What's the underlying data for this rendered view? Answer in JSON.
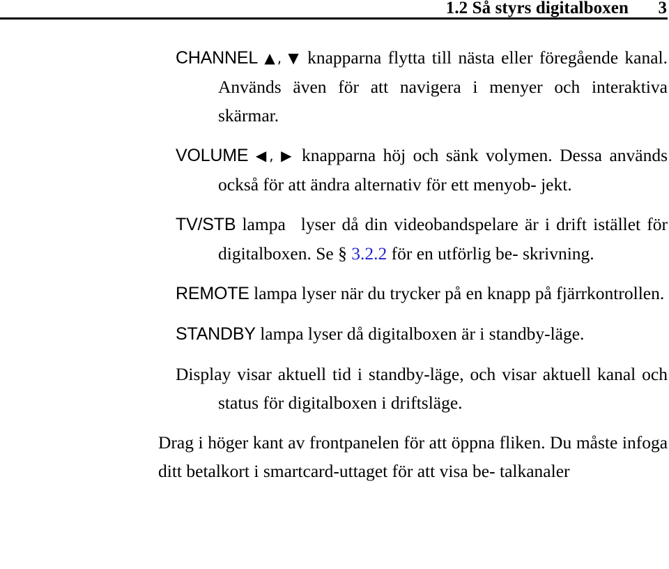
{
  "header": {
    "section_number": "1.2",
    "title": "1.2 Så styrs digitalboxen",
    "page_number": "3"
  },
  "paragraphs": [
    {
      "id": "channel",
      "label": "CHANNEL",
      "icons": [
        "up-triangle-icon",
        "down-triangle-icon"
      ],
      "icon_glyphs": "▲, ▼",
      "text": "knapparna flytta till nästa eller föregående kanal. Används även för att navigera i menyer och interaktiva skärmar."
    },
    {
      "id": "volume",
      "label": "VOLUME",
      "icons": [
        "left-triangle-icon",
        "right-triangle-icon"
      ],
      "icon_glyphs": "◀, ▶",
      "text": "knapparna höj och sänk volymen. Dessa används också för att ändra alternativ för ett menyobjekt."
    },
    {
      "id": "tvstb",
      "label": "TV/STB",
      "text_before_link": "lampa   lyser då din videobandspelare är i drift istället för digitalboxen. Se §",
      "link_text": "3.2.2",
      "text_after_link": "för en utförlig beskrivning."
    },
    {
      "id": "remote",
      "label": "REMOTE",
      "text": "lampa lyser när du trycker på en knapp på fjärrkontrollen."
    },
    {
      "id": "standby",
      "label": "STANDBY",
      "text": "lampa lyser då digitalboxen är i standby-läge."
    },
    {
      "id": "display",
      "label": "Display",
      "text": "visar aktuell tid i standby-läge, och visar aktuell kanal och status för digitalboxen i driftsläge."
    },
    {
      "id": "frontpanel",
      "text": "Drag i höger kant av frontpanelen för att öppna fliken. Du måste infoga ditt betalkort i smartcard-uttaget för att visa betalkanaler"
    }
  ],
  "lines": {
    "channel": [
      "CHANNEL ▲, ▼ knapparna flytta till nästa eller föregående",
      "kanal. Används även för att navigera i menyer och",
      "interaktiva skärmar."
    ],
    "volume": [
      "VOLUME ◀, ▶ knapparna höj och sänk volymen. Dessa",
      "används också för att ändra alternativ för ett menyob-",
      "jekt."
    ],
    "tvstb": [
      "TV/STB lampa   lyser då din videobandspelare är i drift",
      "istället för digitalboxen. Se § 3.2.2 för en utförlig be-",
      "skrivning."
    ],
    "remote": [
      "REMOTE lampa lyser när du trycker på en knapp på",
      "fjärrkontrollen."
    ],
    "standby": [
      "STANDBY lampa lyser då digitalboxen är i standby-läge."
    ],
    "display": [
      "Display visar aktuell tid i standby-läge, och visar aktuell",
      "kanal och status för digitalboxen i driftsläge."
    ],
    "frontpanel": [
      "Drag i höger kant av frontpanelen för att öppna fliken. Du",
      "måste infoga ditt betalkort i smartcard-uttaget för att visa be-",
      "talkanaler"
    ]
  },
  "fragments": {
    "channel_l1_rest": " knapparna flytta till nästa eller föregående",
    "channel_l2": "kanal. Används även för att navigera i menyer och",
    "channel_l3": "interaktiva skärmar.",
    "channel_arrows": "▲, ▼",
    "volume_l1_rest": " knapparna höj och sänk volymen. Dessa",
    "volume_l2": "används också för att ändra alternativ för ett menyob-",
    "volume_l3": "jekt.",
    "volume_arrows": "◀, ▶",
    "tvstb_l1_rest": "lampa",
    "tvstb_l1_tail": "lyser då din videobandspelare är i drift",
    "tvstb_l2a": "istället för digitalboxen. Se §",
    "tvstb_link": "3.2.2",
    "tvstb_l2b": "för en utförlig be-",
    "tvstb_l3": "skrivning.",
    "remote_l1_rest": " lampa lyser när du trycker på en knapp på",
    "remote_l2": "fjärrkontrollen.",
    "standby_l1_rest": " lampa lyser då digitalboxen är i standby-läge.",
    "display_l1_rest": " visar aktuell tid i standby-läge, och visar aktuell",
    "display_l2": "kanal och status för digitalboxen i driftsläge.",
    "front_l1": "Drag i höger kant av frontpanelen för att öppna fliken. Du",
    "front_l2": "måste infoga ditt betalkort i smartcard-uttaget för att visa be-",
    "front_l3": "talkanaler"
  },
  "colors": {
    "text": "#000000",
    "link": "#2222cc",
    "background": "#ffffff",
    "rule": "#000000"
  }
}
